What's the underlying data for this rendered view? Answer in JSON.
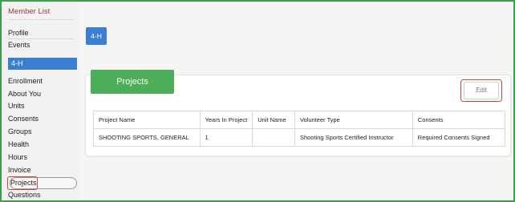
{
  "sidebar": {
    "member_list": "Member List",
    "top_items": [
      "Profile",
      "Events"
    ],
    "section": "4-H",
    "items": [
      "Enrollment",
      "About You",
      "Units",
      "Consents",
      "Groups",
      "Health",
      "Hours",
      "Invoice",
      "Projects",
      "Questions"
    ],
    "active": "Projects"
  },
  "main": {
    "club_chip": "4-H",
    "tab_title": "Projects",
    "edit_label": "Edit",
    "table": {
      "headers": [
        "Project Name",
        "Years In Project",
        "Unit Name",
        "Volunteer Type",
        "Consents"
      ],
      "rows": [
        [
          "SHOOTING SPORTS, GENERAL",
          "1",
          "",
          "Shooting Sports Certified Instructor",
          "Required Consents Signed"
        ]
      ]
    }
  },
  "colors": {
    "accent_blue": "#3b7fd4",
    "green": "#4cae59",
    "highlight_red": "#d3424a",
    "frame_green": "#3aa14a"
  }
}
